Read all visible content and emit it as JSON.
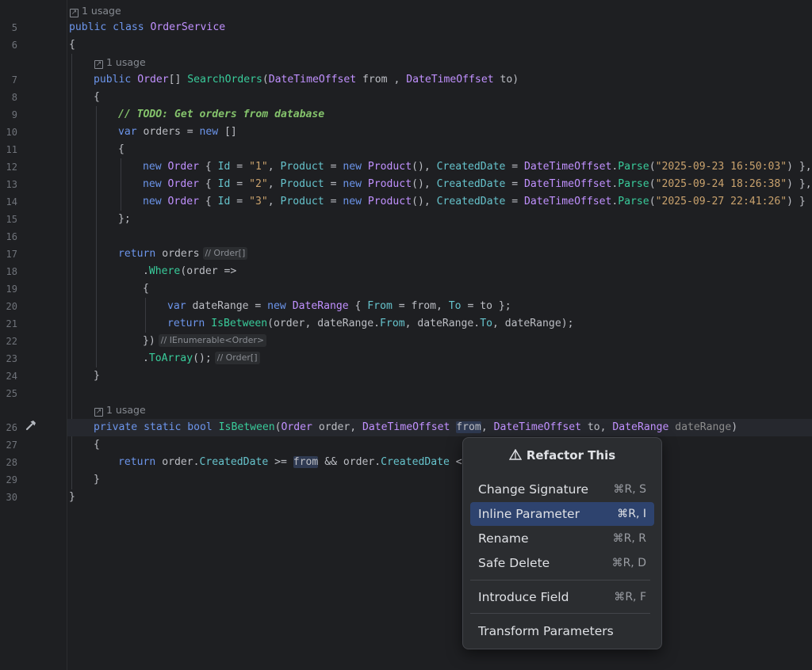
{
  "editor": {
    "hints": {
      "usage1": "1 usage",
      "usage2": "1 usage",
      "usage3": "1 usage"
    },
    "lines": [
      {
        "n": "5"
      },
      {
        "n": "6"
      },
      {
        "n": "7"
      },
      {
        "n": "8"
      },
      {
        "n": "9"
      },
      {
        "n": "10"
      },
      {
        "n": "11"
      },
      {
        "n": "12"
      },
      {
        "n": "13"
      },
      {
        "n": "14"
      },
      {
        "n": "15"
      },
      {
        "n": "16"
      },
      {
        "n": "17"
      },
      {
        "n": "18"
      },
      {
        "n": "19"
      },
      {
        "n": "20"
      },
      {
        "n": "21"
      },
      {
        "n": "22"
      },
      {
        "n": "23"
      },
      {
        "n": "24"
      },
      {
        "n": "25"
      },
      {
        "n": "26"
      },
      {
        "n": "27"
      },
      {
        "n": "28"
      },
      {
        "n": "29"
      },
      {
        "n": "30"
      }
    ],
    "code": {
      "l5_kw": "public class ",
      "l5_ty": "OrderService",
      "brace_open": "{",
      "brace_close": "}",
      "l7_kw": "public ",
      "l7_ty1": "Order",
      "l7_p1": "[] ",
      "l7_mt": "SearchOrders",
      "l7_p2": "(",
      "l7_ty2": "DateTimeOffset",
      "l7_p3": " from , ",
      "l7_ty3": "DateTimeOffset",
      "l7_p4": " to)",
      "l9_cm": "// TODO: Get orders from database",
      "l10_kw1": "var",
      "l10_p1": " orders = ",
      "l10_kw2": "new",
      "l10_p2": " []",
      "l12_kw": "new ",
      "l12_ty": "Order",
      "l12_a": " { ",
      "l12_id": "Id",
      "l12_b": " = ",
      "l12_s1": "\"1\"",
      "l12_c": ", ",
      "l12_pr": "Product",
      "l12_d": " = ",
      "l12_kw2": "new ",
      "l12_ty2": "Product",
      "l12_e": "(), ",
      "l12_cd": "CreatedDate",
      "l12_f": " = ",
      "l12_ty3": "DateTimeOffset",
      "l12_g": ".",
      "l12_mt": "Parse",
      "l12_h": "(",
      "l12_s2": "\"2025-09-23 16:50:03\"",
      "l12_i": ") },",
      "l13_s1": "\"2\"",
      "l13_s2": "\"2025-09-24 18:26:38\"",
      "l13_i": ") },",
      "l14_s1": "\"3\"",
      "l14_s2": "\"2025-09-27 22:41:26\"",
      "l14_i": ") }",
      "l15": "};",
      "l17_kw": "return",
      "l17_p": " orders",
      "l17_inlay": "// Order[]",
      "l18_p1": ".",
      "l18_mt": "Where",
      "l18_p2": "(order =>",
      "l20_kw1": "var",
      "l20_p1": " dateRange = ",
      "l20_kw2": "new ",
      "l20_ty": "DateRange",
      "l20_p2": " { ",
      "l20_pr1": "From",
      "l20_p3": " = from, ",
      "l20_pr2": "To",
      "l20_p4": " = to };",
      "l21_kw": "return ",
      "l21_mt": "IsBetween",
      "l21_p1": "(order, dateRange.",
      "l21_pr1": "From",
      "l21_p2": ", dateRange.",
      "l21_pr2": "To",
      "l21_p3": ", dateRange);",
      "l22_p": "})",
      "l22_inlay": "// IEnumerable<Order>",
      "l23_p1": ".",
      "l23_mt": "ToArray",
      "l23_p2": "();",
      "l23_inlay": "// Order[]",
      "l26_kw": "private static bool ",
      "l26_mt": "IsBetween",
      "l26_p1": "(",
      "l26_ty1": "Order",
      "l26_p2": " order, ",
      "l26_ty2": "DateTimeOffset",
      "l26_p3": " ",
      "l26_hl": "from",
      "l26_p4": ", ",
      "l26_ty3": "DateTimeOffset",
      "l26_p5": " to, ",
      "l26_ty4": "DateRange",
      "l26_p6": " ",
      "l26_pm": "dateRange",
      "l26_p7": ")",
      "l28_kw": "return",
      "l28_p1": " order.",
      "l28_pr1": "CreatedDate",
      "l28_p2": " >= ",
      "l28_hl": "from",
      "l28_p3": " && order.",
      "l28_pr2": "CreatedDate",
      "l28_p4": " <="
    }
  },
  "popup": {
    "title": "Refactor This",
    "items": [
      {
        "label": "Change Signature",
        "shortcut": "⌘R, S"
      },
      {
        "label": "Inline Parameter",
        "shortcut": "⌘R, I"
      },
      {
        "label": "Rename",
        "shortcut": "⌘R, R"
      },
      {
        "label": "Safe Delete",
        "shortcut": "⌘R, D"
      },
      {
        "label": "Introduce Field",
        "shortcut": "⌘R, F"
      },
      {
        "label": "Transform Parameters",
        "shortcut": ""
      }
    ],
    "selected_index": 1
  },
  "colors": {
    "background": "#1e1f22",
    "keyword": "#6c95eb",
    "type": "#c191ff",
    "method": "#39cc9b",
    "string": "#c9a26d",
    "comment": "#85c46c",
    "selection": "#2e436e"
  },
  "icons": {
    "gutter_line26": "hammer-icon",
    "usage_hint": "external-link-icon",
    "popup_title": "refactor-prism-icon"
  }
}
